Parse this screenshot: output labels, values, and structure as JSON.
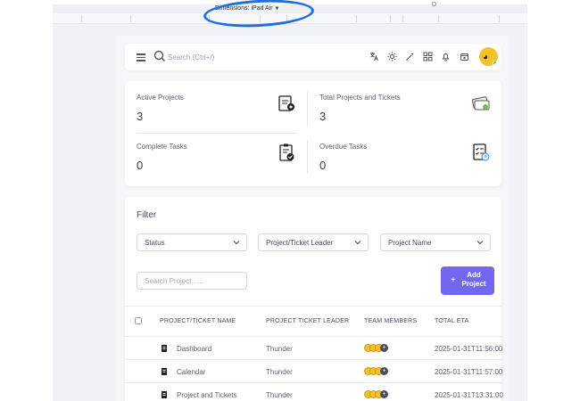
{
  "devtools": {
    "dimensions_label": "Dimensions: iPad Air",
    "extra_label": "D"
  },
  "navbar": {
    "search_placeholder": "Search (Ctrl+/)",
    "icons": [
      "menu-icon",
      "search-icon",
      "translate-icon",
      "sun-icon",
      "magic-wand-icon",
      "grid-icon",
      "bell-icon",
      "calendar-icon"
    ]
  },
  "stats": [
    {
      "label": "Active Projects",
      "value": "3",
      "icon": "clipboard-gear-icon"
    },
    {
      "label": "Total Projects and Tickets",
      "value": "3",
      "icon": "tickets-icon"
    },
    {
      "label": "Complete Tasks",
      "value": "0",
      "icon": "clipboard-check-icon"
    },
    {
      "label": "Overdue Tasks",
      "value": "0",
      "icon": "checklist-clock-icon"
    }
  ],
  "filter": {
    "title": "Filter",
    "status_select": "Status",
    "leader_select": "Project/Ticket Leader",
    "name_select": "Project Name",
    "search_placeholder": "Search Project .....",
    "add_button_plus": "+",
    "add_button_label": "Add Project"
  },
  "table": {
    "columns": [
      "PROJECT/TICKET NAME",
      "PROJECT TICKET LEADER",
      "TEAM MEMBERS",
      "TOTAL ETA"
    ],
    "rows": [
      {
        "name": "Dashboard",
        "leader": "Thunder",
        "eta": "2025-01-31T11:56:00"
      },
      {
        "name": "Calendar",
        "leader": "Thunder",
        "eta": "2025-01-31T11:57:00"
      },
      {
        "name": "Project and Tickets",
        "leader": "Thunder",
        "eta": "2025-01-31T13:31:00"
      }
    ]
  },
  "colors": {
    "primary": "#7367f0",
    "annotation": "#1f6fde",
    "avatar": "#f3c22a",
    "online": "#28c76f"
  }
}
